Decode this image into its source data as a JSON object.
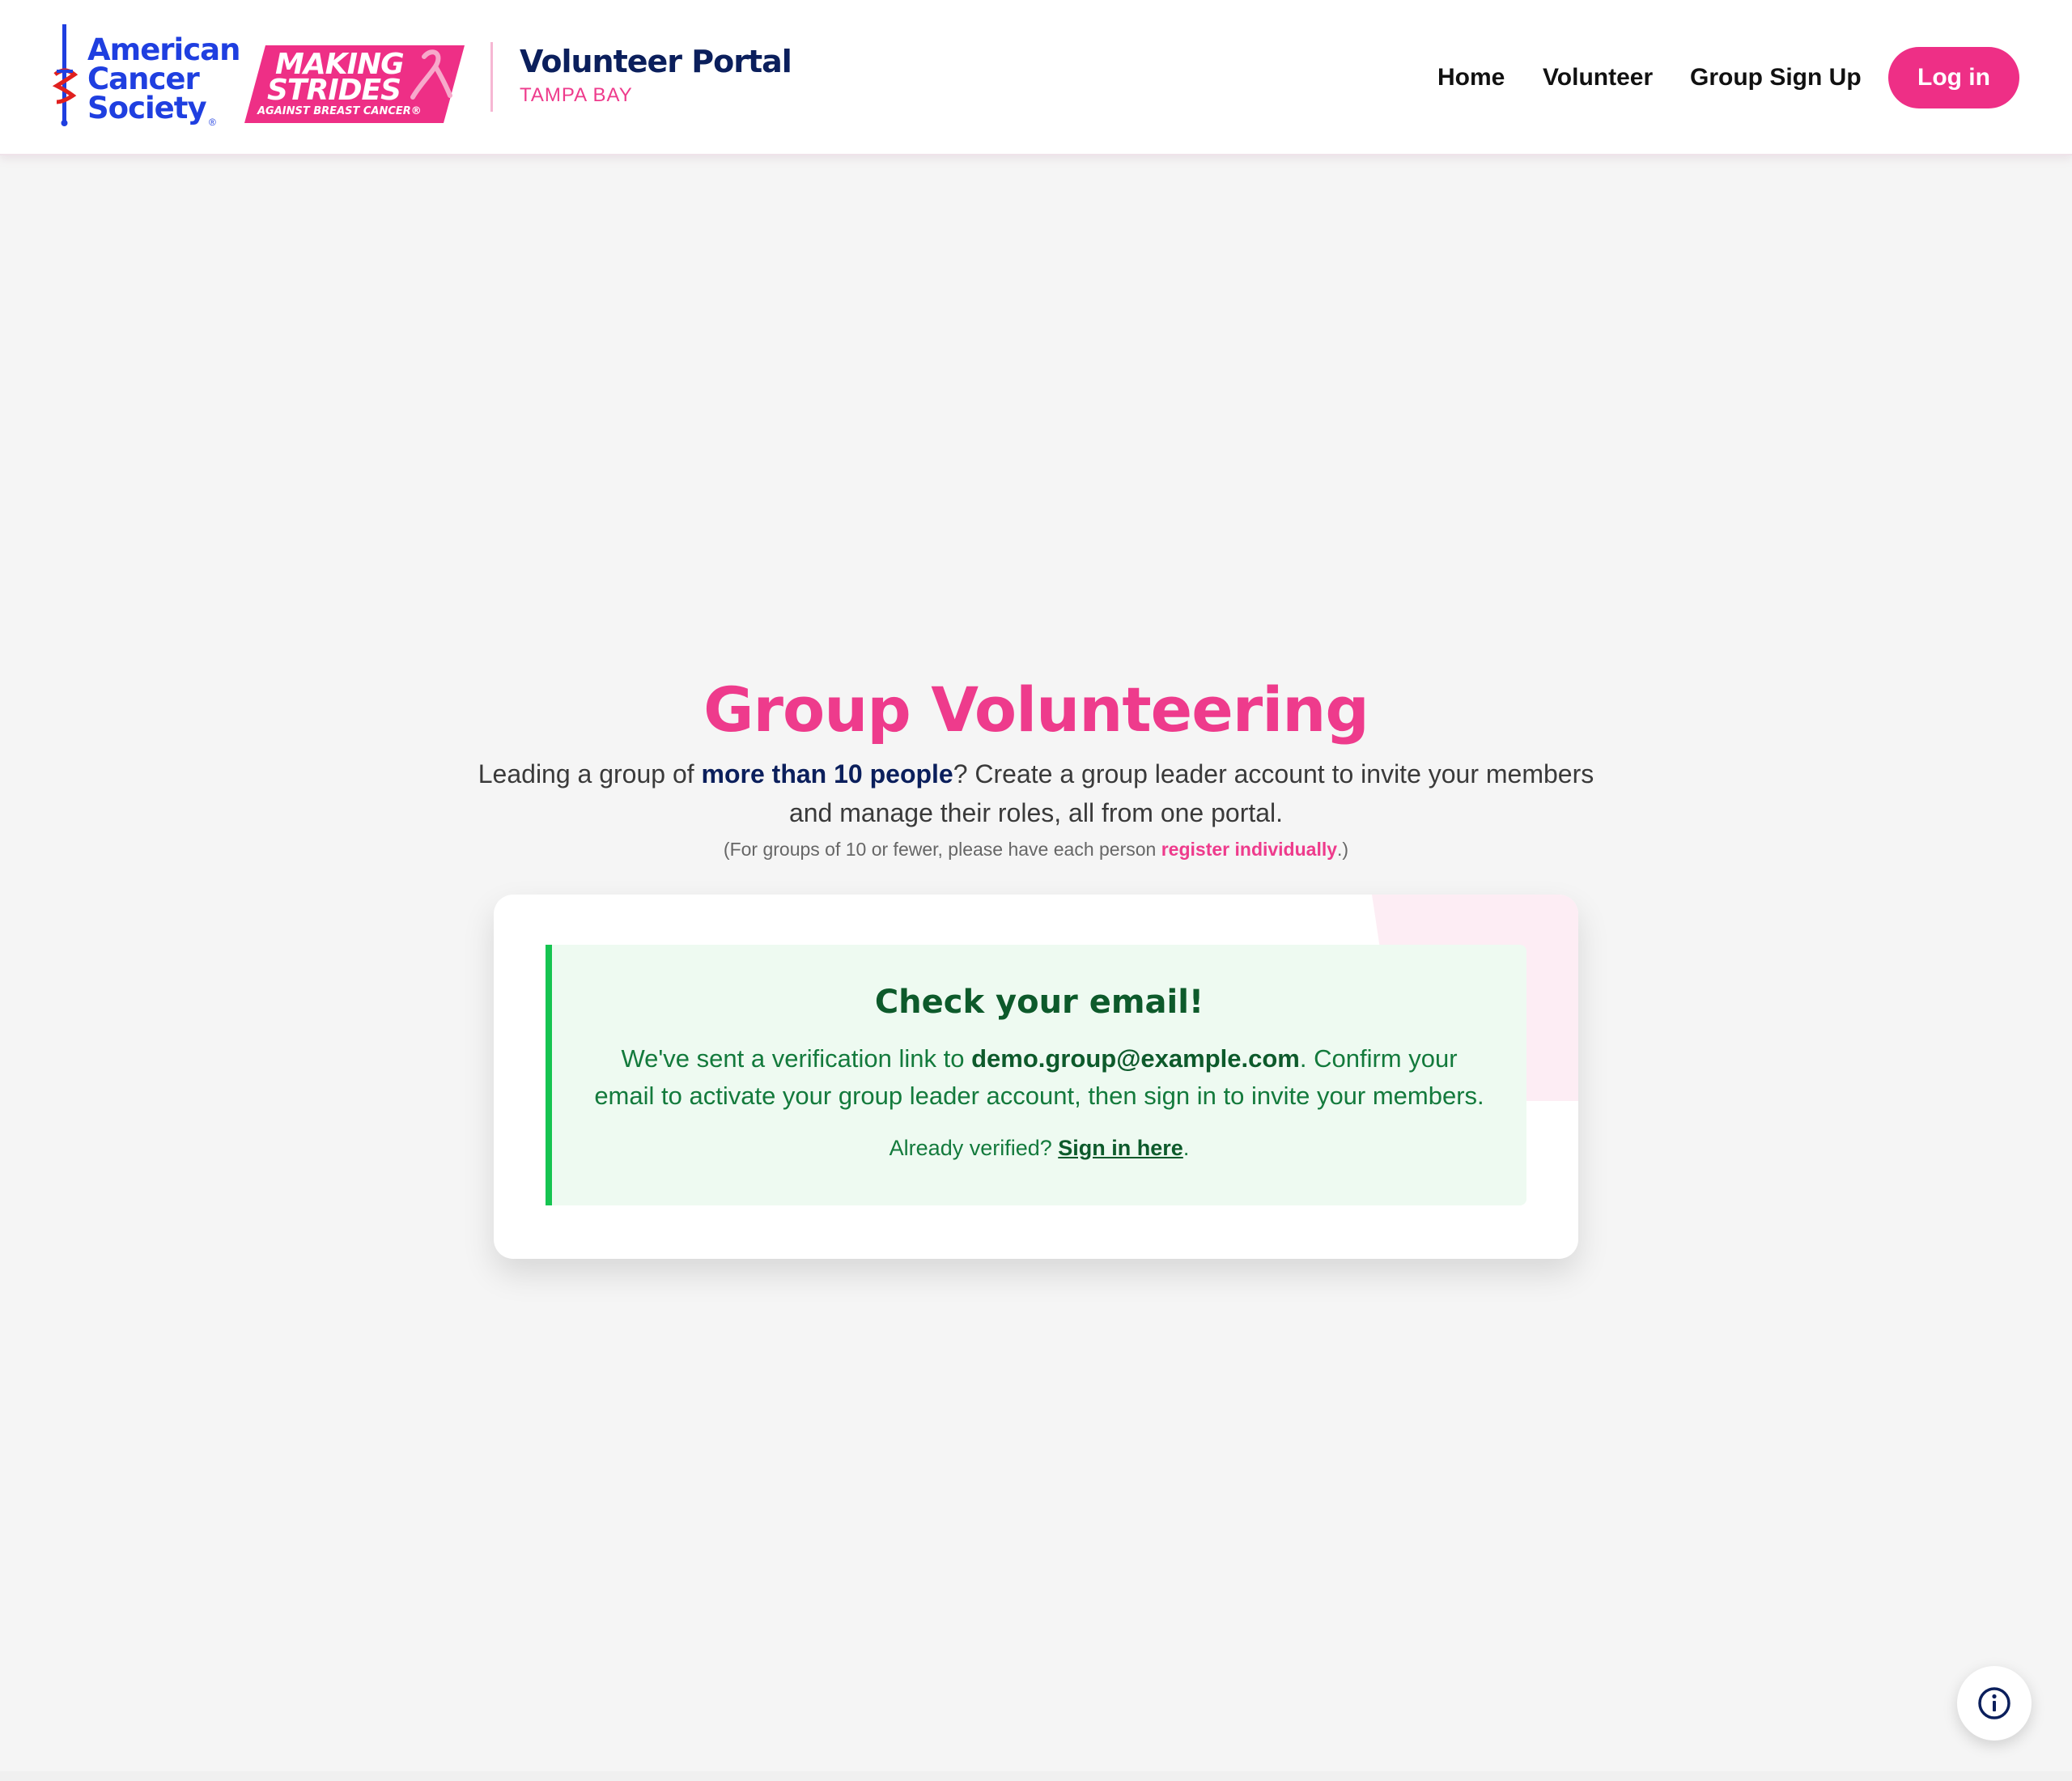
{
  "header": {
    "acs_logo": {
      "line1": "American",
      "line2": "Cancer",
      "line3": "Society",
      "reg": "®"
    },
    "ms_logo": {
      "line1": "MAKING",
      "line2": "STRIDES",
      "line3": "AGAINST BREAST CANCER®"
    },
    "portal_title": "Volunteer Portal",
    "portal_subtitle": "TAMPA BAY",
    "nav": {
      "home": "Home",
      "volunteer": "Volunteer",
      "group_sign_up": "Group Sign Up"
    },
    "login_label": "Log in"
  },
  "hero": {
    "title": "Group Volunteering",
    "intro_before": "Leading a group of ",
    "intro_bold": "more than 10 people",
    "intro_after": "? Create a group leader account to invite your members and manage their roles, all from one portal.",
    "note_before": "(For groups of 10 or fewer, please have each person ",
    "note_link": "register individually",
    "note_after": ".)"
  },
  "alert": {
    "title": "Check your email!",
    "body_before": "We've sent a verification link to ",
    "email": "demo.group@example.com",
    "body_after": ". Confirm your email to activate your group leader account, then sign in to invite your members.",
    "foot_before": "Already verified? ",
    "foot_link": "Sign in here",
    "foot_after": "."
  },
  "icons": {
    "info_fab": "info-icon"
  },
  "colors": {
    "brand_pink": "#ee3b8c",
    "brand_navy": "#0b1f5c",
    "acs_blue": "#1f3fe0",
    "success_green": "#16c451",
    "success_bg": "#eefaf1"
  }
}
